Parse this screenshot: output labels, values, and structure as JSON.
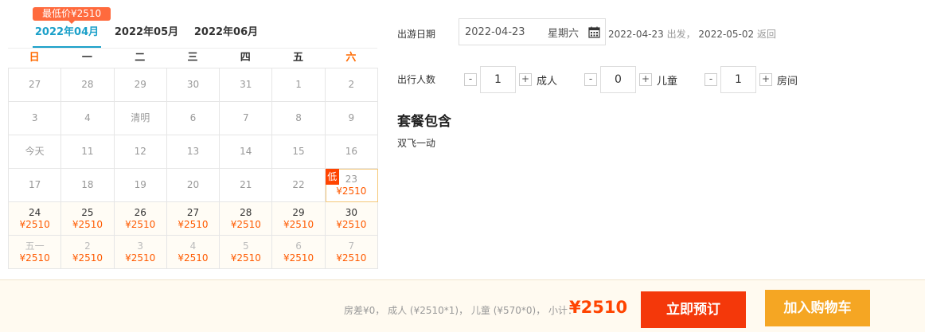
{
  "calendar": {
    "lowest_badge": "最低价¥2510",
    "months": [
      "2022年04月",
      "2022年05月",
      "2022年06月"
    ],
    "weekdays": [
      "日",
      "一",
      "二",
      "三",
      "四",
      "五",
      "六"
    ],
    "days": [
      {
        "d": "27",
        "p": "",
        "s": "past"
      },
      {
        "d": "28",
        "p": "",
        "s": "past"
      },
      {
        "d": "29",
        "p": "",
        "s": "past"
      },
      {
        "d": "30",
        "p": "",
        "s": "past"
      },
      {
        "d": "31",
        "p": "",
        "s": "past"
      },
      {
        "d": "1",
        "p": "",
        "s": "past"
      },
      {
        "d": "2",
        "p": "",
        "s": "past"
      },
      {
        "d": "3",
        "p": "",
        "s": "past"
      },
      {
        "d": "4",
        "p": "",
        "s": "past"
      },
      {
        "d": "清明",
        "p": "",
        "s": "past"
      },
      {
        "d": "6",
        "p": "",
        "s": "past"
      },
      {
        "d": "7",
        "p": "",
        "s": "past"
      },
      {
        "d": "8",
        "p": "",
        "s": "past"
      },
      {
        "d": "9",
        "p": "",
        "s": "past"
      },
      {
        "d": "今天",
        "p": "",
        "s": "past"
      },
      {
        "d": "11",
        "p": "",
        "s": "past"
      },
      {
        "d": "12",
        "p": "",
        "s": "past"
      },
      {
        "d": "13",
        "p": "",
        "s": "past"
      },
      {
        "d": "14",
        "p": "",
        "s": "past"
      },
      {
        "d": "15",
        "p": "",
        "s": "past"
      },
      {
        "d": "16",
        "p": "",
        "s": "past"
      },
      {
        "d": "17",
        "p": "",
        "s": "past"
      },
      {
        "d": "18",
        "p": "",
        "s": "past"
      },
      {
        "d": "19",
        "p": "",
        "s": "past"
      },
      {
        "d": "20",
        "p": "",
        "s": "past"
      },
      {
        "d": "21",
        "p": "",
        "s": "past"
      },
      {
        "d": "22",
        "p": "",
        "s": "past"
      },
      {
        "d": "23",
        "p": "¥2510",
        "s": "selected",
        "tag": "低"
      },
      {
        "d": "24",
        "p": "¥2510",
        "s": "avail"
      },
      {
        "d": "25",
        "p": "¥2510",
        "s": "avail"
      },
      {
        "d": "26",
        "p": "¥2510",
        "s": "avail"
      },
      {
        "d": "27",
        "p": "¥2510",
        "s": "avail"
      },
      {
        "d": "28",
        "p": "¥2510",
        "s": "avail"
      },
      {
        "d": "29",
        "p": "¥2510",
        "s": "avail"
      },
      {
        "d": "30",
        "p": "¥2510",
        "s": "avail"
      },
      {
        "d": "五一",
        "p": "¥2510",
        "s": "next"
      },
      {
        "d": "2",
        "p": "¥2510",
        "s": "next"
      },
      {
        "d": "3",
        "p": "¥2510",
        "s": "next"
      },
      {
        "d": "4",
        "p": "¥2510",
        "s": "next"
      },
      {
        "d": "5",
        "p": "¥2510",
        "s": "next"
      },
      {
        "d": "6",
        "p": "¥2510",
        "s": "next"
      },
      {
        "d": "7",
        "p": "¥2510",
        "s": "next"
      }
    ]
  },
  "travel": {
    "date_label": "出游日期",
    "date_value": "2022-04-23",
    "weekday": "星期六",
    "range": {
      "start": "2022-04-23",
      "start_word": "出发，",
      "end": "2022-05-02",
      "end_word": "返回"
    }
  },
  "people": {
    "label": "出行人数",
    "minus": "-",
    "plus": "+",
    "adult": {
      "value": "1",
      "unit": "成人"
    },
    "child": {
      "value": "0",
      "unit": "儿童"
    },
    "room": {
      "value": "1",
      "unit": "房间"
    }
  },
  "package": {
    "title": "套餐包含",
    "content": "双飞一动"
  },
  "footer": {
    "summary": "房差¥0， 成人 (¥2510*1)， 儿童 (¥570*0)， 小计：",
    "total": "¥2510",
    "book": "立即预订",
    "cart": "加入购物车"
  },
  "colors": {
    "accent": "#1ba0c9",
    "price": "#ff4400",
    "book": "#f4380a",
    "cart": "#f5a623"
  }
}
